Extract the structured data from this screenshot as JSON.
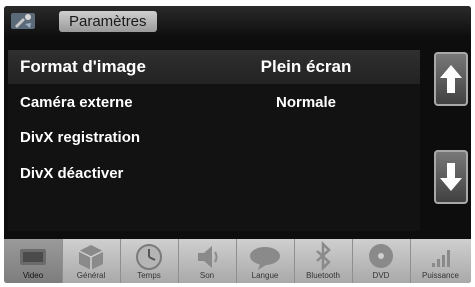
{
  "header": {
    "title": "Paramètres",
    "app_icon": "settings-tools-icon"
  },
  "settings": [
    {
      "label": "Format d'image",
      "value": "Plein écran"
    },
    {
      "label": "Caméra externe",
      "value": "Normale"
    },
    {
      "label": "DivX registration",
      "value": ""
    },
    {
      "label": "DivX déactiver",
      "value": ""
    }
  ],
  "scroll": {
    "up_icon": "arrow-up-icon",
    "down_icon": "arrow-down-icon"
  },
  "tabs": [
    {
      "label": "Video",
      "icon": "video-icon"
    },
    {
      "label": "Général",
      "icon": "cube-icon"
    },
    {
      "label": "Temps",
      "icon": "clock-icon"
    },
    {
      "label": "Son",
      "icon": "speaker-icon"
    },
    {
      "label": "Langue",
      "icon": "language-icon"
    },
    {
      "label": "Bluetooth",
      "icon": "bluetooth-icon"
    },
    {
      "label": "DVD",
      "icon": "disc-icon"
    },
    {
      "label": "Puissance",
      "icon": "signal-bars-icon"
    }
  ],
  "colors": {
    "background": "#0d0d0d",
    "text": "#ffffff",
    "tab_bar": "#bdbdbd"
  }
}
